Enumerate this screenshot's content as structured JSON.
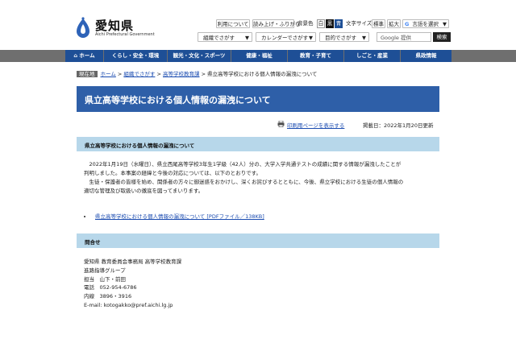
{
  "header": {
    "logo_name": "愛知県",
    "logo_sub": "Aichi Prefectural Government",
    "utility": {
      "usage": "利用について",
      "readout": "読み上げ・ふりがな",
      "bg_color_label": "背景色",
      "bg_white": "白",
      "bg_black": "黒",
      "bg_blue": "青",
      "font_size_label": "文字サイズ",
      "size_standard": "標準",
      "size_large": "拡大",
      "language": "言語を選択"
    },
    "organization_search": "組織でさがす",
    "calendar_search": "カレンダーでさがす",
    "purpose_search": "目的でさがす",
    "search_placeholder": "Google 提供",
    "search_button": "検索"
  },
  "nav": {
    "items": [
      "ホーム",
      "くらし・安全・環境",
      "観光・文化・スポーツ",
      "健康・福祉",
      "教育・子育て",
      "しごと・産業",
      "県政情報"
    ]
  },
  "breadcrumb": {
    "here_label": "現在地",
    "home": "ホーム",
    "sep": " > ",
    "org": "組織でさがす",
    "division": "高等学校教育課",
    "current": "県立高等学校における個人情報の漏洩について"
  },
  "main": {
    "title": "県立高等学校における個人情報の漏洩について",
    "print_link": "印刷用ページを表示する",
    "updated": "掲載日：2022年1月20日更新",
    "section_heading": "県立高等学校における個人情報の漏洩について",
    "para1_line1": "　2022年1月19日（水曜日）、県立西尾高等学校3年生1学級（42人）分の、大学入学共通テストの成績に関する情報が漏洩したことが",
    "para1_line2": "判明しました。本事案の経緯と今後の対応については、以下のとおりです。",
    "para2_line1": "　生徒・保護者の皆様を始め、関係者の方々に御迷惑をおかけし、深くお詫びするとともに、今後、県立学校における生徒の個人情報の",
    "para2_line2": "適切な管理及び取扱いの徹底を図ってまいります。",
    "pdf_link": "県立高等学校における個人情報の漏洩について [PDFファイル／138KB]"
  },
  "contact": {
    "heading": "問合せ",
    "org": "愛知県 教育委員会事務局 高等学校教育課",
    "group": "進路指導グループ",
    "person": "担当　山下・前田",
    "phone": "電話　052-954-6786",
    "ext": "内線　3896・3916",
    "email": "E-mail: kotogakko@pref.aichi.lg.jp"
  },
  "colors": {
    "nav_blue": "#1e4f96",
    "title_blue": "#2e5fa8",
    "section_bg": "#b7d7ea",
    "link": "#1a4bb0"
  }
}
